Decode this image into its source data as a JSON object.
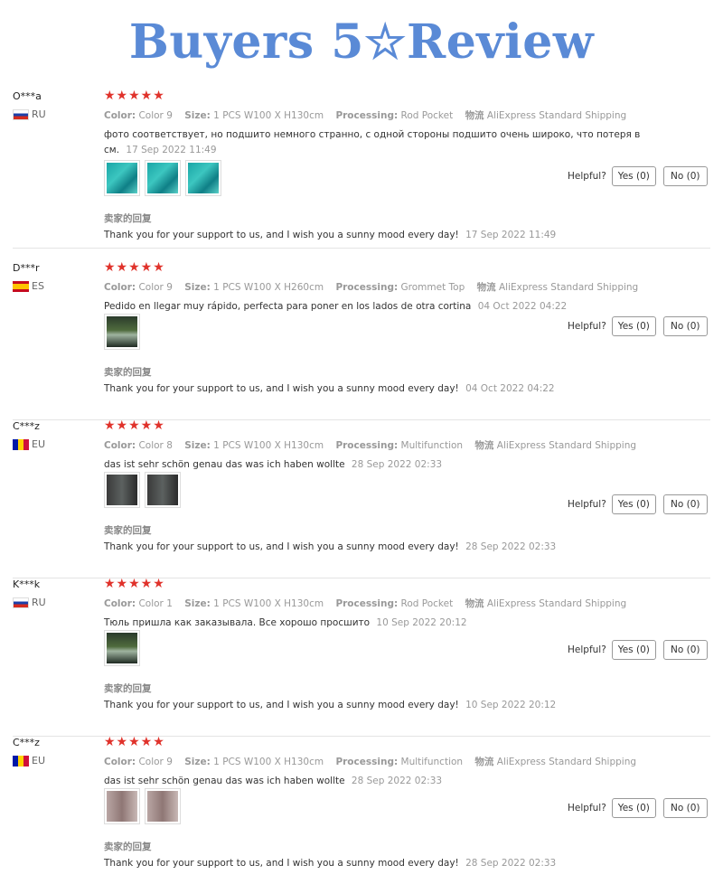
{
  "banner": {
    "title": "Buyers 5☆Review"
  },
  "labels": {
    "color": "Color:",
    "size": "Size:",
    "processing": "Processing:",
    "shipping": "物流",
    "helpful": "Helpful?",
    "yes": "Yes (0)",
    "no": "No (0)",
    "seller_reply_label": "卖家的回复"
  },
  "colors": {
    "accent": "#5a8ad6",
    "stars": "#e0322b"
  },
  "reviews": [
    {
      "user": "O***a",
      "country": "RU",
      "flag": "flag-ru",
      "stars": "★★★★★",
      "color": "Color 9",
      "size": "1 PCS W100 X H130cm",
      "processing": "Rod Pocket",
      "shipping": "AliExpress Standard Shipping",
      "comment": "фото соответствует, но подшито немного странно, с одной стороны подшито очень широко, что потеря в см.",
      "comment_date": "17 Sep 2022 11:49",
      "thumbs": [
        "teal-curtain",
        "teal-curtain",
        "teal-curtain"
      ],
      "reply": "Thank you for your support to us, and I wish you a sunny mood every day!",
      "reply_date": "17 Sep 2022 11:49"
    },
    {
      "user": "D***r",
      "country": "ES",
      "flag": "flag-es",
      "stars": "★★★★★",
      "color": "Color 9",
      "size": "1 PCS W100 X H260cm",
      "processing": "Grommet Top",
      "shipping": "AliExpress Standard Shipping",
      "comment": "Pedido en llegar muy rápido, perfecta para poner en los lados de otra cortina",
      "comment_date": "04 Oct 2022 04:22",
      "thumbs": [
        "window-photo"
      ],
      "reply": "Thank you for your support to us, and I wish you a sunny mood every day!",
      "reply_date": "04 Oct 2022 04:22"
    },
    {
      "user": "C***z",
      "country": "EU",
      "flag": "flag-eu",
      "stars": "★★★★★",
      "color": "Color 8",
      "size": "1 PCS W100 X H130cm",
      "processing": "Multifunction",
      "shipping": "AliExpress Standard Shipping",
      "comment": "das ist sehr schön genau das was ich haben wollte",
      "comment_date": "28 Sep 2022 02:33",
      "thumbs": [
        "dark-curtain",
        "dark-curtain"
      ],
      "reply": "Thank you for your support to us, and I wish you a sunny mood every day!",
      "reply_date": "28 Sep 2022 02:33"
    },
    {
      "user": "K***k",
      "country": "RU",
      "flag": "flag-ru",
      "stars": "★★★★★",
      "color": "Color 1",
      "size": "1 PCS W100 X H130cm",
      "processing": "Rod Pocket",
      "shipping": "AliExpress Standard Shipping",
      "comment": "Тюль пришла как заказывала. Все хорошо просшито",
      "comment_date": "10 Sep 2022 20:12",
      "thumbs": [
        "window-photo"
      ],
      "reply": "Thank you for your support to us, and I wish you a sunny mood every day!",
      "reply_date": "10 Sep 2022 20:12"
    },
    {
      "user": "C***z",
      "country": "EU",
      "flag": "flag-eu",
      "stars": "★★★★★",
      "color": "Color 9",
      "size": "1 PCS W100 X H130cm",
      "processing": "Multifunction",
      "shipping": "AliExpress Standard Shipping",
      "comment": "das ist sehr schön genau das was ich haben wollte",
      "comment_date": "28 Sep 2022 02:33",
      "thumbs": [
        "pink-curtain",
        "pink-curtain"
      ],
      "reply": "Thank you for your support to us, and I wish you a sunny mood every day!",
      "reply_date": "28 Sep 2022 02:33"
    }
  ]
}
